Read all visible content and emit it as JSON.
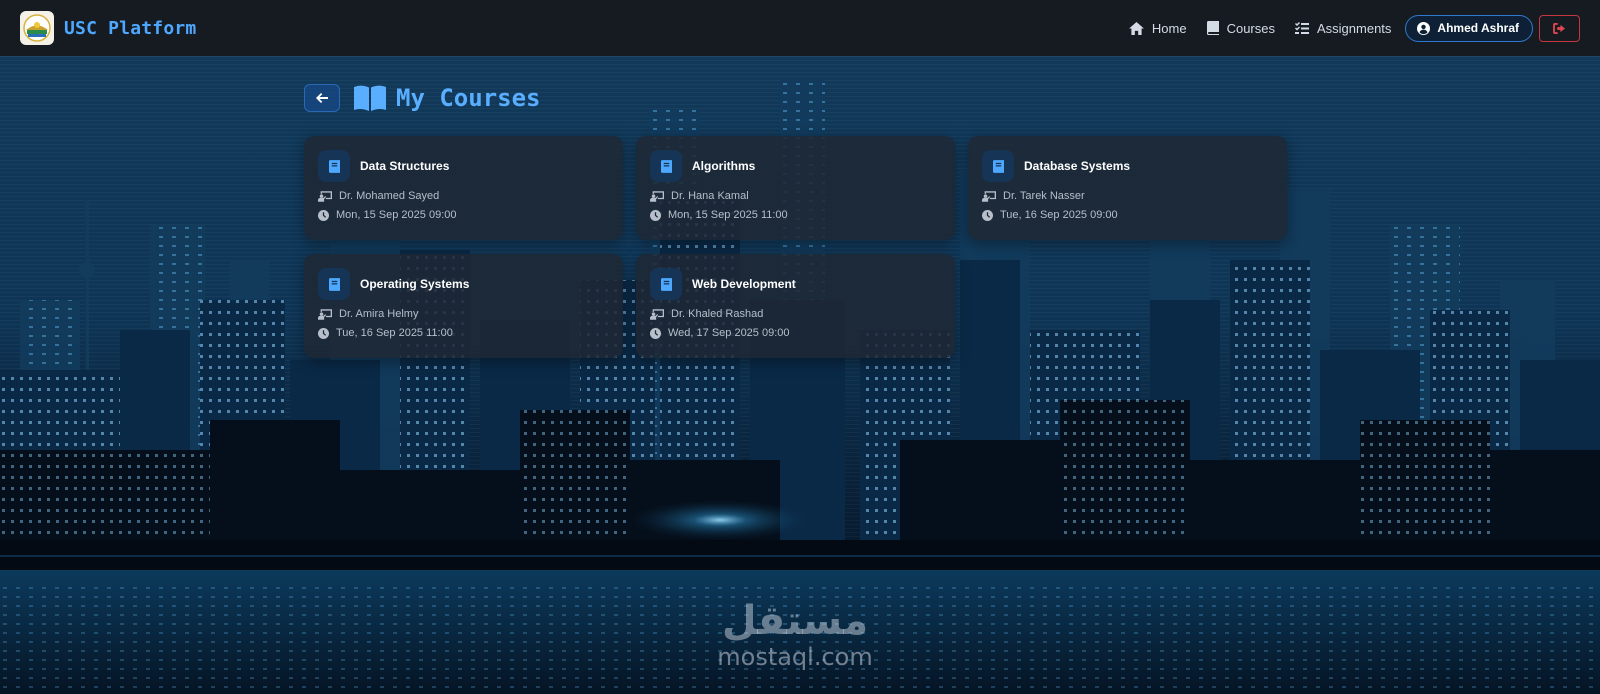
{
  "app": {
    "brand": "USC Platform"
  },
  "nav": {
    "items": [
      {
        "label": "Home",
        "icon": "home-icon"
      },
      {
        "label": "Courses",
        "icon": "book-icon"
      },
      {
        "label": "Assignments",
        "icon": "list-check-icon"
      }
    ],
    "user": {
      "name": "Ahmed Ashraf",
      "icon": "user-circle-icon"
    },
    "logout_icon": "sign-out-icon"
  },
  "page": {
    "title": "My Courses",
    "back_icon": "arrow-left-icon",
    "title_icon": "open-book-icon"
  },
  "courses": [
    {
      "name": "Data Structures",
      "instructor": "Dr. Mohamed Sayed",
      "schedule": "Mon, 15 Sep 2025 09:00"
    },
    {
      "name": "Algorithms",
      "instructor": "Dr. Hana Kamal",
      "schedule": "Mon, 15 Sep 2025 11:00"
    },
    {
      "name": "Database Systems",
      "instructor": "Dr. Tarek Nasser",
      "schedule": "Tue, 16 Sep 2025 09:00"
    },
    {
      "name": "Operating Systems",
      "instructor": "Dr. Amira Helmy",
      "schedule": "Tue, 16 Sep 2025 11:00"
    },
    {
      "name": "Web Development",
      "instructor": "Dr. Khaled Rashad",
      "schedule": "Wed, 17 Sep 2025 09:00"
    }
  ],
  "watermark": {
    "arabic": "مستقل",
    "latin": "mostaql.com"
  },
  "colors": {
    "accent": "#4ea8ff",
    "navbar_bg": "#161b22",
    "card_bg": "#1e2834",
    "danger": "#c4363d"
  }
}
